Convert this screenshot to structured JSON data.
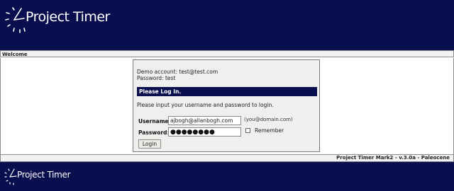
{
  "header": {
    "logo_text": "Project Timer",
    "logo_icon": "clock-icon"
  },
  "welcome_bar": {
    "label": "Welcome"
  },
  "login": {
    "demo_account": "Demo account: test@test.com",
    "demo_password": "Password: test",
    "title": "Please Log In.",
    "instructions": "Please input your username and password to login.",
    "username_label": "Username",
    "username_value": "ajbogh@allanbogh.com",
    "username_hint": "(you@domain.com)",
    "password_label": "Password",
    "password_mask": "●●●●●●●●",
    "remember_label": "Remember",
    "login_button": "Login"
  },
  "status_bar": {
    "version_text": "Project Timer Mark2 - v.3.0a - Paleocene"
  },
  "footer": {
    "logo_text": "Project Timer"
  },
  "colors": {
    "brand_navy": "#080e4e",
    "panel_bg": "#efefed",
    "bar_bg": "#f2f2f2"
  }
}
